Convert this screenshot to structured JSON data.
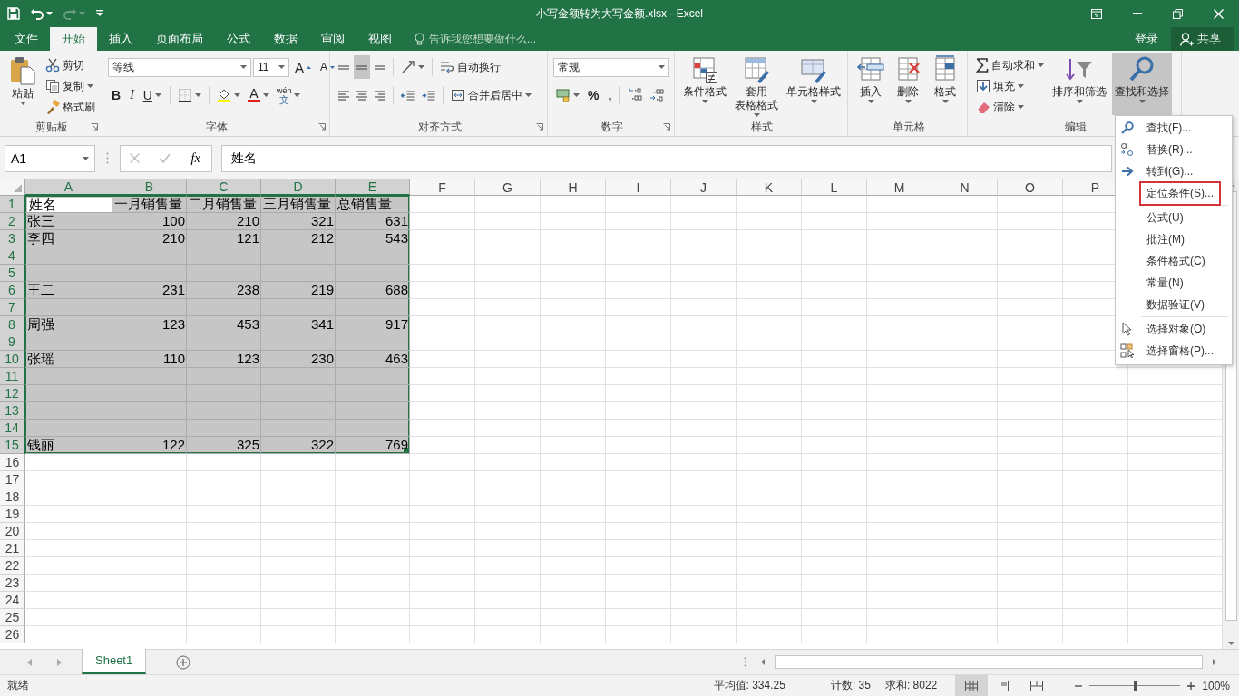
{
  "window": {
    "title": "小写金额转为大写金额.xlsx - Excel"
  },
  "ribbon_tabs": [
    {
      "label": "文件",
      "selected": false
    },
    {
      "label": "开始",
      "selected": true
    },
    {
      "label": "插入",
      "selected": false
    },
    {
      "label": "页面布局",
      "selected": false
    },
    {
      "label": "公式",
      "selected": false
    },
    {
      "label": "数据",
      "selected": false
    },
    {
      "label": "审阅",
      "selected": false
    },
    {
      "label": "视图",
      "selected": false
    }
  ],
  "tell_me": {
    "placeholder": "告诉我您想要做什么..."
  },
  "account": {
    "sign_in": "登录",
    "share": "共享"
  },
  "clipboard": {
    "label": "剪贴板",
    "paste": "粘贴",
    "cut": "剪切",
    "copy": "复制",
    "format_painter": "格式刷"
  },
  "font": {
    "label": "字体",
    "font_name": "等线",
    "font_size": "11",
    "grow_font": "A",
    "shrink_font": "A",
    "bold": "B",
    "italic": "I",
    "underline": "U",
    "font_color": "A",
    "phonetic": "wén",
    "phonetic_char": "文"
  },
  "alignment": {
    "label": "对齐方式",
    "vertical_align": [
      {
        "selected": false
      },
      {
        "selected": true
      },
      {
        "selected": false
      }
    ],
    "wrap_text": "自动换行",
    "merge_center": "合并后居中"
  },
  "number": {
    "label": "数字",
    "format": "常规",
    "percent": "%",
    "comma": ","
  },
  "styles": {
    "label": "样式",
    "buttons": [
      {
        "lines": [
          "条件格式"
        ]
      },
      {
        "lines": [
          "套用",
          "表格格式"
        ]
      },
      {
        "lines": [
          "单元格样式"
        ]
      }
    ]
  },
  "cells": {
    "label": "单元格",
    "buttons": [
      "插入",
      "删除",
      "格式"
    ]
  },
  "editing": {
    "label": "编辑",
    "autosum": "自动求和",
    "fill": "填充",
    "clear": "清除",
    "sort_filter": "排序和筛选",
    "find_select": {
      "label": "查找和选择",
      "selected": true
    }
  },
  "formula_bar": {
    "name_box": "A1",
    "function_button": "fx",
    "value": "姓名"
  },
  "sheet": {
    "columns": [
      {
        "label": "A",
        "selected": true
      },
      {
        "label": "B",
        "selected": true
      },
      {
        "label": "C",
        "selected": true
      },
      {
        "label": "D",
        "selected": true
      },
      {
        "label": "E",
        "selected": true
      },
      {
        "label": "F",
        "selected": false
      },
      {
        "label": "G",
        "selected": false
      },
      {
        "label": "H",
        "selected": false
      },
      {
        "label": "I",
        "selected": false
      },
      {
        "label": "J",
        "selected": false
      },
      {
        "label": "K",
        "selected": false
      },
      {
        "label": "L",
        "selected": false
      },
      {
        "label": "M",
        "selected": false
      },
      {
        "label": "N",
        "selected": false
      },
      {
        "label": "O",
        "selected": false
      },
      {
        "label": "P",
        "selected": false
      }
    ],
    "rows": [
      {
        "header": "1",
        "kind": "header",
        "selected": true,
        "cells": [
          "姓名",
          "一月销售量",
          "二月销售量",
          "三月销售量",
          "总销售量"
        ]
      },
      {
        "header": "2",
        "kind": "data",
        "selected": true,
        "cells": [
          "张三",
          "100",
          "210",
          "321",
          "631"
        ]
      },
      {
        "header": "3",
        "kind": "data",
        "selected": true,
        "cells": [
          "李四",
          "210",
          "121",
          "212",
          "543"
        ]
      },
      {
        "header": "4",
        "selected": true
      },
      {
        "header": "5",
        "selected": true
      },
      {
        "header": "6",
        "kind": "data",
        "selected": true,
        "cells": [
          "王二",
          "231",
          "238",
          "219",
          "688"
        ]
      },
      {
        "header": "7",
        "selected": true
      },
      {
        "header": "8",
        "kind": "data",
        "selected": true,
        "cells": [
          "周强",
          "123",
          "453",
          "341",
          "917"
        ]
      },
      {
        "header": "9",
        "selected": true
      },
      {
        "header": "10",
        "kind": "data",
        "selected": true,
        "cells": [
          "张瑶",
          "110",
          "123",
          "230",
          "463"
        ]
      },
      {
        "header": "11",
        "selected": true
      },
      {
        "header": "12",
        "selected": true
      },
      {
        "header": "13",
        "selected": true
      },
      {
        "header": "14",
        "selected": true
      },
      {
        "header": "15",
        "kind": "data",
        "selected": true,
        "cells": [
          "钱丽",
          "122",
          "325",
          "322",
          "769"
        ]
      },
      {
        "header": "16",
        "selected": false
      },
      {
        "header": "17",
        "selected": false
      },
      {
        "header": "18",
        "selected": false
      },
      {
        "header": "19",
        "selected": false
      },
      {
        "header": "20",
        "selected": false
      },
      {
        "header": "21",
        "selected": false
      },
      {
        "header": "22",
        "selected": false
      },
      {
        "header": "23",
        "selected": false
      },
      {
        "header": "24",
        "selected": false
      },
      {
        "header": "25",
        "selected": false
      },
      {
        "header": "26",
        "selected": false
      }
    ]
  },
  "find_menu": {
    "items": [
      {
        "label": "查找(F)...",
        "kind": "find",
        "highlighted": false,
        "separator_before": false
      },
      {
        "label": "替换(R)...",
        "kind": "replace",
        "highlighted": false,
        "separator_before": false
      },
      {
        "label": "转到(G)...",
        "kind": "goto",
        "highlighted": false,
        "separator_before": false
      },
      {
        "label": "定位条件(S)...",
        "kind": "plain",
        "highlighted": true,
        "separator_before": false
      },
      {
        "label": "公式(U)",
        "kind": "plain",
        "highlighted": false,
        "separator_before": true
      },
      {
        "label": "批注(M)",
        "kind": "plain",
        "highlighted": false,
        "separator_before": false
      },
      {
        "label": "条件格式(C)",
        "kind": "plain",
        "highlighted": false,
        "separator_before": false
      },
      {
        "label": "常量(N)",
        "kind": "plain",
        "highlighted": false,
        "separator_before": false
      },
      {
        "label": "数据验证(V)",
        "kind": "plain",
        "highlighted": false,
        "separator_before": false
      },
      {
        "label": "选择对象(O)",
        "kind": "select-objects",
        "highlighted": false,
        "separator_before": true
      },
      {
        "label": "选择窗格(P)...",
        "kind": "selection-pane",
        "highlighted": false,
        "separator_before": false
      }
    ]
  },
  "sheet_tabs": [
    {
      "label": "Sheet1",
      "selected": true
    }
  ],
  "status_bar": {
    "status": "就绪",
    "average": "平均值: 334.25",
    "count": "计数: 35",
    "sum": "求和: 8022",
    "views": [
      {
        "selected": true
      },
      {
        "selected": false
      },
      {
        "selected": false
      }
    ],
    "zoom": {
      "level": 0.5,
      "reading": "100%"
    }
  }
}
